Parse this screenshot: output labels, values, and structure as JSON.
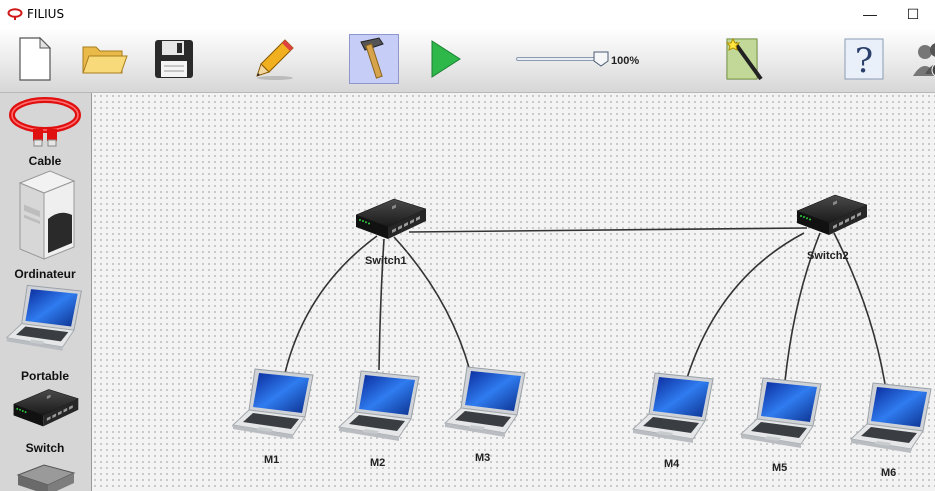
{
  "window": {
    "title": "FILIUS",
    "minimize_glyph": "—",
    "maximize_glyph": "☐"
  },
  "toolbar": {
    "buttons": [
      {
        "name": "new-document-icon"
      },
      {
        "name": "open-folder-icon"
      },
      {
        "name": "save-floppy-icon"
      },
      {
        "name": "design-pencil-icon"
      },
      {
        "name": "build-hammer-icon",
        "active": true
      },
      {
        "name": "run-play-icon"
      },
      {
        "name": "wizard-magic-wand-icon"
      },
      {
        "name": "help-question-icon"
      },
      {
        "name": "info-users-icon"
      }
    ],
    "zoom_label": "100%"
  },
  "palette": {
    "items": [
      {
        "label": "Cable",
        "icon": "cable-icon"
      },
      {
        "label": "Ordinateur",
        "icon": "computer-tower-icon"
      },
      {
        "label": "Portable",
        "icon": "laptop-icon"
      },
      {
        "label": "Switch",
        "icon": "switch-icon"
      },
      {
        "label": "",
        "icon": "router-icon"
      }
    ]
  },
  "network": {
    "switches": [
      {
        "id": "sw1",
        "label": "Switch1"
      },
      {
        "id": "sw2",
        "label": "Switch2"
      }
    ],
    "laptops": [
      {
        "id": "m1",
        "label": "M1",
        "connected_to": "sw1"
      },
      {
        "id": "m2",
        "label": "M2",
        "connected_to": "sw1"
      },
      {
        "id": "m3",
        "label": "M3",
        "connected_to": "sw1"
      },
      {
        "id": "m4",
        "label": "M4",
        "connected_to": "sw2"
      },
      {
        "id": "m5",
        "label": "M5",
        "connected_to": "sw2"
      },
      {
        "id": "m6",
        "label": "M6",
        "connected_to": "sw2"
      }
    ],
    "links": [
      [
        "sw1",
        "sw2"
      ],
      [
        "sw1",
        "m1"
      ],
      [
        "sw1",
        "m2"
      ],
      [
        "sw1",
        "m3"
      ],
      [
        "sw2",
        "m4"
      ],
      [
        "sw2",
        "m5"
      ],
      [
        "sw2",
        "m6"
      ]
    ],
    "colors": {
      "cable": "#333333",
      "switch_body": "#1c1c1c",
      "screen": "#1f5fd6",
      "led": "#2ecc40"
    }
  }
}
